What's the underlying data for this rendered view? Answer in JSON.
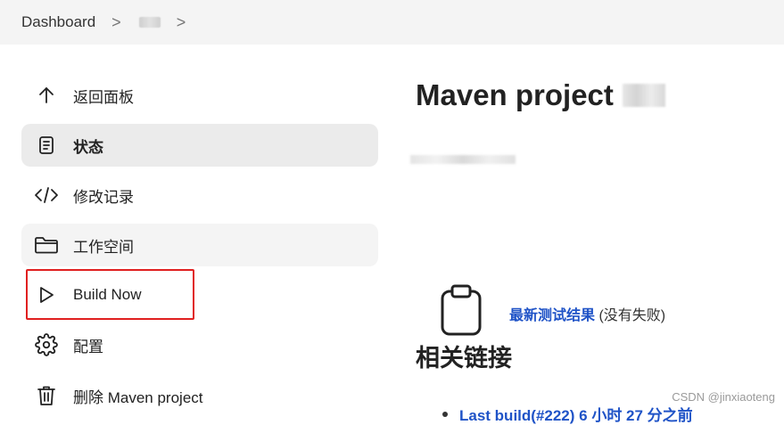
{
  "breadcrumb": {
    "items": [
      "Dashboard"
    ],
    "separator": ">"
  },
  "sidebar": {
    "items": [
      {
        "label": "返回面板",
        "icon": "arrow-up-icon"
      },
      {
        "label": "状态",
        "icon": "document-icon",
        "active": true
      },
      {
        "label": "修改记录",
        "icon": "code-icon"
      },
      {
        "label": "工作空间",
        "icon": "folder-icon"
      },
      {
        "label": "Build Now",
        "icon": "play-icon",
        "highlighted": true
      },
      {
        "label": "配置",
        "icon": "gear-icon"
      },
      {
        "label": "删除 Maven project",
        "icon": "trash-icon"
      }
    ]
  },
  "main": {
    "title": "Maven project",
    "test_result": {
      "link_label": "最新测试结果",
      "note": "(没有失败)"
    },
    "related_links_heading": "相关链接",
    "last_build_label": "Last build(#222) 6 小时 27 分之前"
  },
  "watermark": "CSDN @jinxiaoteng",
  "colors": {
    "accent_link": "#1f53c7",
    "highlight_border": "#e02020",
    "active_bg": "#ebebeb",
    "breadcrumb_bg": "#f4f4f4"
  }
}
